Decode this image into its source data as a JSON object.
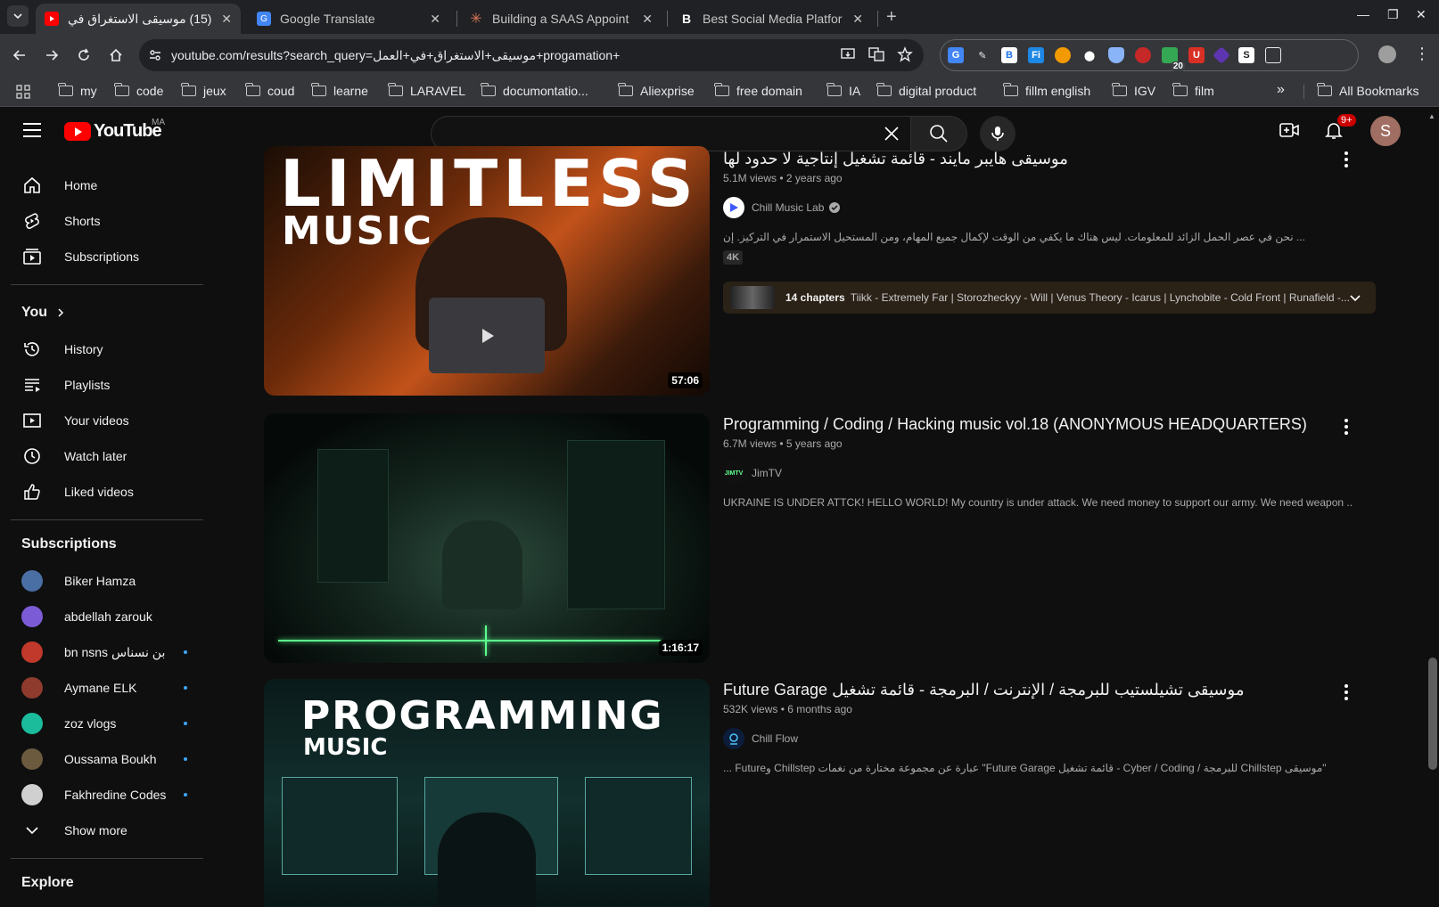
{
  "browser": {
    "tabs": [
      {
        "title": "(15) موسيقى الاستغراق في",
        "close": "✕",
        "active": true
      },
      {
        "title": "Google Translate",
        "close": "✕",
        "active": false
      },
      {
        "title": "Building a SAAS Appoint",
        "close": "✕",
        "active": false
      },
      {
        "title": "Best Social Media Platfor",
        "close": "✕",
        "active": false
      }
    ],
    "url": "youtube.com/results?search_query=موسيقى+الاستغراق+في+العمل+progamation+",
    "extension_badge": "20",
    "bookmarks": [
      "my",
      "code",
      "jeux",
      "coud",
      "learne",
      "LARAVEL",
      "documontatio...",
      "Aliexprise",
      "free domain",
      "IA",
      "digital product",
      "fillm english",
      "IGV",
      "film"
    ],
    "all_bookmarks": "All Bookmarks",
    "overflow": "»"
  },
  "masthead": {
    "logo_text": "YouTube",
    "country": "MA",
    "search_value": "",
    "notifications": "9+",
    "avatar_letter": "S"
  },
  "sidebar": {
    "main": [
      {
        "label": "Home",
        "icon": "home-icon"
      },
      {
        "label": "Shorts",
        "icon": "shorts-icon"
      },
      {
        "label": "Subscriptions",
        "icon": "subscriptions-icon"
      }
    ],
    "you_label": "You",
    "you": [
      {
        "label": "History",
        "icon": "history-icon"
      },
      {
        "label": "Playlists",
        "icon": "playlists-icon"
      },
      {
        "label": "Your videos",
        "icon": "your-videos-icon"
      },
      {
        "label": "Watch later",
        "icon": "watch-later-icon"
      },
      {
        "label": "Liked videos",
        "icon": "liked-videos-icon"
      }
    ],
    "subscriptions_label": "Subscriptions",
    "subscriptions": [
      {
        "name": "Biker Hamza",
        "color": "#4a6fa5",
        "live": false
      },
      {
        "name": "abdellah zarouk",
        "color": "#7b5cd6",
        "live": false
      },
      {
        "name": "bn nsns بن نسناس",
        "color": "#c0392b",
        "live": true
      },
      {
        "name": "Aymane ELK",
        "color": "#8e3b2e",
        "live": true
      },
      {
        "name": "zoz vlogs",
        "color": "#1abc9c",
        "live": true
      },
      {
        "name": "Oussama Boukh",
        "color": "#6b5a3e",
        "live": true
      },
      {
        "name": "Fakhredine Codes",
        "color": "#d0d0d0",
        "live": true
      }
    ],
    "show_more": "Show more",
    "explore_label": "Explore"
  },
  "results": [
    {
      "title": "موسيقى هايبر مايند - قائمة تشغيل إنتاجية لا حدود لها",
      "stats": "5.1M views • 2 years ago",
      "channel": "Chill Music Lab",
      "verified": true,
      "description": "... نحن في عصر الحمل الزائد للمعلومات. ليس هناك ما يكفي من الوقت لإكمال جميع المهام، ومن المستحيل الاستمرار في التركيز. إن",
      "badge": "4K",
      "chapters_count": "14 chapters",
      "chapters_text": "Tiikk - Extremely Far | Storozheckyy - Will | Venus Theory - Icarus | Lynchobite - Cold Front | Runafield -...",
      "duration": "57:06",
      "thumb_line1": "LIMITLESS",
      "thumb_line2": "MUSIC"
    },
    {
      "title": "Programming / Coding / Hacking music vol.18 (ANONYMOUS HEADQUARTERS)",
      "stats": "6.7M views • 5 years ago",
      "channel": "JimTV",
      "channel_logo_text": "JIMTV",
      "description": "UKRAINE IS UNDER ATTCK! HELLO WORLD! My country is under attack. We need money to support our army. We need weapon ...",
      "duration": "1:16:17"
    },
    {
      "title": "موسيقى تشيلستيب للبرمجة / الإنترنت / البرمجة - قائمة تشغيل Future Garage",
      "stats": "532K views • 6 months ago",
      "channel": "Chill Flow",
      "description": "\"موسيقى Chillstep للبرمجة / Cyber / Coding - قائمة تشغيل Future Garage\" عبارة عن مجموعة مختارة من نغمات Chillstep وFuture ...",
      "thumb_line1": "PROGRAMMING",
      "thumb_line2": "MUSIC"
    }
  ]
}
